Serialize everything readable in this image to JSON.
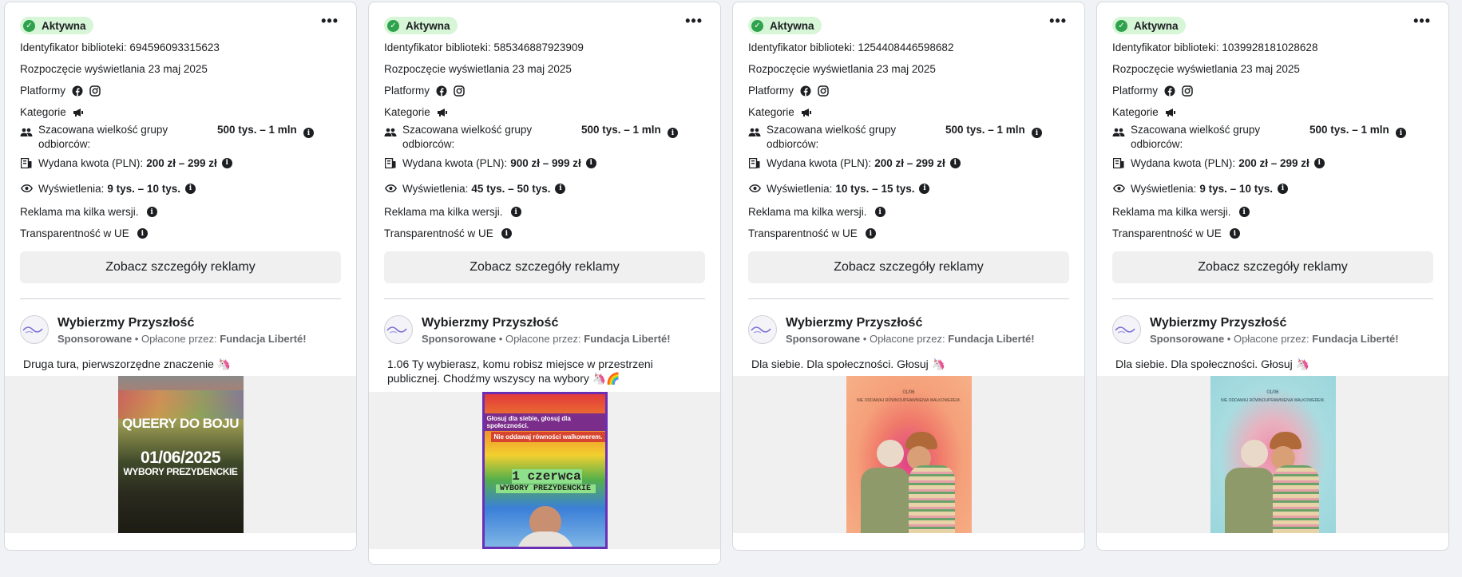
{
  "cards": [
    {
      "status": "Aktywna",
      "library_id": "Identyfikator biblioteki: 694596093315623",
      "start": "Rozpoczęcie wyświetlania 23 maj 2025",
      "platforms_label": "Platformy",
      "categories_label": "Kategorie",
      "audience_label": "Szacowana wielkość grupy odbiorców:",
      "audience_value": "500 tys. – 1 mln",
      "spend_label": "Wydana kwota (PLN):",
      "spend_value": "200 zł – 299 zł",
      "views_label": "Wyświetlenia:",
      "views_value": "9 tys. – 10 tys.",
      "versions": "Reklama ma kilka wersji.",
      "transparency": "Transparentność w UE",
      "details_button": "Zobacz szczegóły reklamy",
      "page_name": "Wybierzmy Przyszłość",
      "sponsored": "Sponsorowane",
      "paid_by_label": " • Opłacone przez: ",
      "paid_by": "Fundacja Liberté!",
      "ad_text": "Druga tura, pierwszorzędne znaczenie 🦄",
      "image": {
        "line1": "QUEERY DO BOJU",
        "line2": "01/06/2025",
        "line3": "WYBORY PREZYDENCKIE"
      }
    },
    {
      "status": "Aktywna",
      "library_id": "Identyfikator biblioteki: 585346887923909",
      "start": "Rozpoczęcie wyświetlania 23 maj 2025",
      "platforms_label": "Platformy",
      "categories_label": "Kategorie",
      "audience_label": "Szacowana wielkość grupy odbiorców:",
      "audience_value": "500 tys. – 1 mln",
      "spend_label": "Wydana kwota (PLN):",
      "spend_value": "900 zł – 999 zł",
      "views_label": "Wyświetlenia:",
      "views_value": "45 tys. – 50 tys.",
      "versions": "Reklama ma kilka wersji.",
      "transparency": "Transparentność w UE",
      "details_button": "Zobacz szczegóły reklamy",
      "page_name": "Wybierzmy Przyszłość",
      "sponsored": "Sponsorowane",
      "paid_by_label": " • Opłacone przez: ",
      "paid_by": "Fundacja Liberté!",
      "ad_text": "1.06 Ty wybierasz, komu robisz miejsce w przestrzeni publicznej. Chodźmy wszyscy na wybory 🦄🌈",
      "image": {
        "line1": "Głosuj dla siebie, głosuj dla społeczności.",
        "line2": "Nie oddawaj równości walkowerem.",
        "line3": "1 czerwca",
        "line4": "WYBORY PREZYDENCKIE"
      }
    },
    {
      "status": "Aktywna",
      "library_id": "Identyfikator biblioteki: 1254408446598682",
      "start": "Rozpoczęcie wyświetlania 23 maj 2025",
      "platforms_label": "Platformy",
      "categories_label": "Kategorie",
      "audience_label": "Szacowana wielkość grupy odbiorców:",
      "audience_value": "500 tys. – 1 mln",
      "spend_label": "Wydana kwota (PLN):",
      "spend_value": "200 zł – 299 zł",
      "views_label": "Wyświetlenia:",
      "views_value": "10 tys. – 15 tys.",
      "versions": "Reklama ma kilka wersji.",
      "transparency": "Transparentność w UE",
      "details_button": "Zobacz szczegóły reklamy",
      "page_name": "Wybierzmy Przyszłość",
      "sponsored": "Sponsorowane",
      "paid_by_label": " • Opłacone przez: ",
      "paid_by": "Fundacja Liberté!",
      "ad_text": "Dla siebie. Dla społeczności. Głosuj 🦄",
      "image": {
        "line1": "01/06",
        "line2": "NIE ODDAWAJ RÓWNOUPRAWNIENIA WALKOWEREM."
      }
    },
    {
      "status": "Aktywna",
      "library_id": "Identyfikator biblioteki: 1039928181028628",
      "start": "Rozpoczęcie wyświetlania 23 maj 2025",
      "platforms_label": "Platformy",
      "categories_label": "Kategorie",
      "audience_label": "Szacowana wielkość grupy odbiorców:",
      "audience_value": "500 tys. – 1 mln",
      "spend_label": "Wydana kwota (PLN):",
      "spend_value": "200 zł – 299 zł",
      "views_label": "Wyświetlenia:",
      "views_value": "9 tys. – 10 tys.",
      "versions": "Reklama ma kilka wersji.",
      "transparency": "Transparentność w UE",
      "details_button": "Zobacz szczegóły reklamy",
      "page_name": "Wybierzmy Przyszłość",
      "sponsored": "Sponsorowane",
      "paid_by_label": " • Opłacone przez: ",
      "paid_by": "Fundacja Liberté!",
      "ad_text": "Dla siebie. Dla społeczności. Głosuj 🦄",
      "image": {
        "line1": "01/06",
        "line2": "NIE ODDAWAJ RÓWNOUPRAWNIENIA WALKOWEREM."
      }
    }
  ],
  "colors": {
    "active_badge_bg": "#d7f5d7",
    "active_dot": "#2ea24c",
    "page_bg": "#f0f2f5",
    "button_bg": "#f0f0f0"
  }
}
